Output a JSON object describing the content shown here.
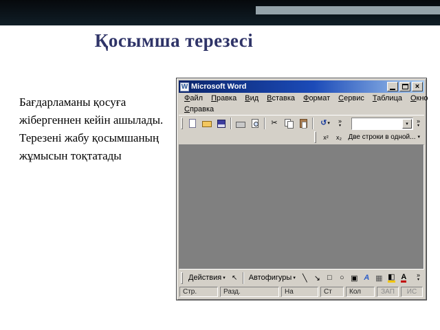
{
  "slide": {
    "title": "Қосымша терезесі",
    "body": "Бағдарламаны қосуға жібергеннен кейін ашылады. Терезені жабу қосымшаның жұмысын тоқтатады"
  },
  "win": {
    "title": "Microsoft Word",
    "window_icon": "W",
    "close_glyph": "×",
    "menu_items": [
      "Файл",
      "Правка",
      "Вид",
      "Вставка",
      "Формат",
      "Сервис",
      "Таблица",
      "Окно",
      "Справка"
    ],
    "icons": {
      "cut": "✂",
      "undo": "↺",
      "dropdown": "▾",
      "chevron": "»"
    },
    "asian_layout": {
      "icons": [
        {
          "name": "superscript-icon",
          "glyph": "x²"
        },
        {
          "name": "subscript-icon",
          "glyph": "x₂"
        }
      ],
      "label": "Две строки в одной..."
    },
    "drawing": {
      "actions_label": "Действия",
      "autoshapes_label": "Автофигуры",
      "icons": [
        {
          "name": "select-objects-icon",
          "glyph": "↖"
        },
        {
          "name": "line-icon",
          "glyph": "╲"
        },
        {
          "name": "arrow-icon",
          "glyph": "↘"
        },
        {
          "name": "rectangle-icon",
          "glyph": "□"
        },
        {
          "name": "oval-icon",
          "glyph": "○"
        },
        {
          "name": "text-box-icon",
          "glyph": "▣"
        },
        {
          "name": "wordart-icon",
          "glyph": "A"
        },
        {
          "name": "diagram-icon",
          "glyph": "▦"
        },
        {
          "name": "fill-color-icon",
          "glyph": "◧"
        },
        {
          "name": "font-color-icon",
          "glyph": "А"
        }
      ]
    },
    "status_cells": [
      "Стр.",
      "Разд.",
      "На",
      "Ст",
      "Кол"
    ],
    "status_right": [
      "ЗАП",
      "ИС"
    ]
  },
  "colors": {
    "band": "#0d161c",
    "band_accent": "#95a3aa",
    "title_text": "#2f3468",
    "titlebar_start": "#0a246a",
    "titlebar_end": "#a6caf0",
    "window_face": "#d4d0c8",
    "document_area": "#808080"
  }
}
